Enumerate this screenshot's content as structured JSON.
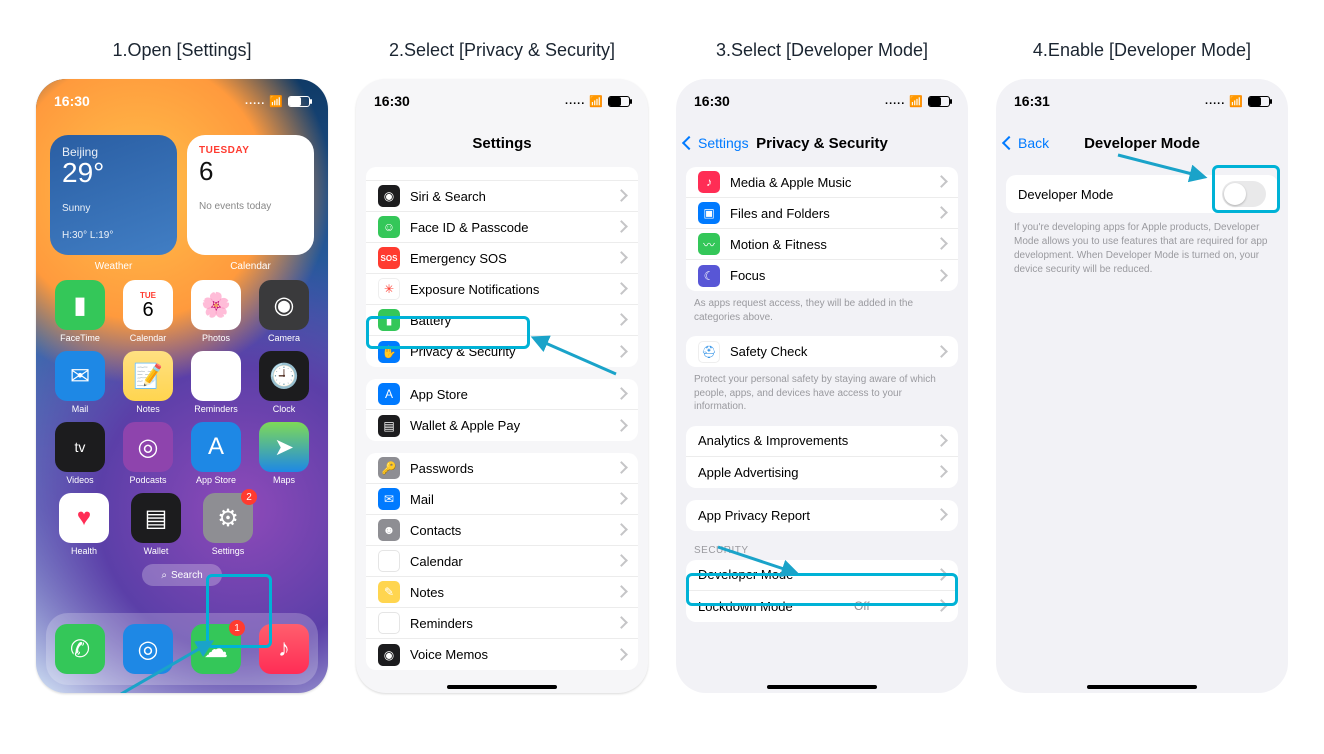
{
  "steps": {
    "s1": "1.Open [Settings]",
    "s2": "2.Select [Privacy & Security]",
    "s3": "3.Select [Developer Mode]",
    "s4": "4.Enable [Developer Mode]"
  },
  "status": {
    "t1": "16:30",
    "t2": "16:30",
    "t3": "16:30",
    "t4": "16:31",
    "dots": "....."
  },
  "home": {
    "weather": {
      "city": "Beijing",
      "temp": "29°",
      "cond": "Sunny",
      "hilo": "H:30° L:19°"
    },
    "cal": {
      "dow": "TUESDAY",
      "day": "6",
      "none": "No events today"
    },
    "wlab": {
      "a": "Weather",
      "b": "Calendar"
    },
    "apps": {
      "r1": {
        "a": "FaceTime",
        "b": "Calendar",
        "c": "Photos",
        "d": "Camera"
      },
      "r2": {
        "a": "Mail",
        "b": "Notes",
        "c": "Reminders",
        "d": "Clock"
      },
      "r3": {
        "a": "Videos",
        "b": "Podcasts",
        "c": "App Store",
        "d": "Maps"
      },
      "r4": {
        "a": "Health",
        "b": "Wallet",
        "c": "Settings"
      }
    },
    "cal_tile": {
      "dow": "TUE",
      "day": "6"
    },
    "search": "Search",
    "badges": {
      "settings": "2",
      "messages": "1"
    }
  },
  "settings": {
    "title": "Settings",
    "rows": {
      "siri": "Siri & Search",
      "faceid": "Face ID & Passcode",
      "sos": "Emergency SOS",
      "exposure": "Exposure Notifications",
      "battery": "Battery",
      "privacy": "Privacy & Security",
      "appstore": "App Store",
      "wallet": "Wallet & Apple Pay",
      "passwords": "Passwords",
      "mail": "Mail",
      "contacts": "Contacts",
      "calendar": "Calendar",
      "notes": "Notes",
      "reminders": "Reminders",
      "voicememos": "Voice Memos"
    }
  },
  "privacy": {
    "back": "Settings",
    "title": "Privacy & Security",
    "rows": {
      "media": "Media & Apple Music",
      "files": "Files and Folders",
      "motion": "Motion & Fitness",
      "focus": "Focus",
      "safety": "Safety Check",
      "analytics": "Analytics & Improvements",
      "ads": "Apple Advertising",
      "appreport": "App Privacy Report",
      "devmode": "Developer Mode",
      "lockdown": "Lockdown Mode"
    },
    "lockdown_detail": "Off",
    "hint1": "As apps request access, they will be added in the categories above.",
    "hint2": "Protect your personal safety by staying aware of which people, apps, and devices have access to your information.",
    "sec_label": "SECURITY"
  },
  "dev": {
    "back": "Back",
    "title": "Developer Mode",
    "row": "Developer Mode",
    "desc": "If you're developing apps for Apple products, Developer Mode allows you to use features that are required for app development. When Developer Mode is turned on, your device security will be reduced."
  }
}
